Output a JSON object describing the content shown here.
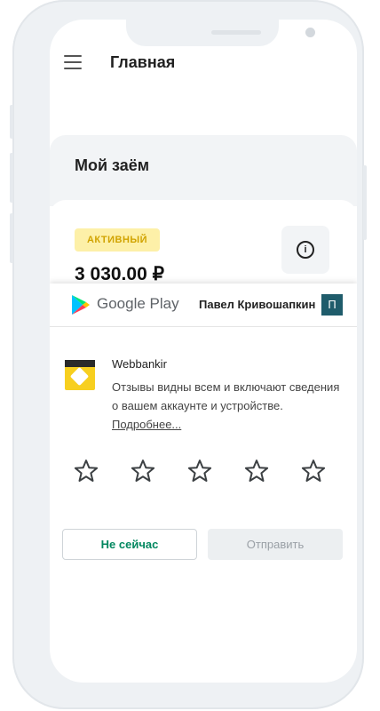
{
  "app_bar": {
    "title": "Главная",
    "menu_icon": "hamburger-menu-icon"
  },
  "loan": {
    "section_title": "Мой заём",
    "status_badge": "АКТИВНЫЙ",
    "amount": "3 030.00 ₽",
    "info_icon": "info-icon"
  },
  "review_sheet": {
    "store_name": "Google Play",
    "user_name": "Павел Кривошапкин",
    "avatar_letter": "П",
    "app_name": "Webbankir",
    "description": "Отзывы видны всем и включают сведения о вашем аккаунте и устройстве.",
    "more_link": "Подробнее...",
    "stars": [
      {
        "icon": "star-outline-icon"
      },
      {
        "icon": "star-outline-icon"
      },
      {
        "icon": "star-outline-icon"
      },
      {
        "icon": "star-outline-icon"
      },
      {
        "icon": "star-outline-icon"
      }
    ],
    "later_label": "Не сейчас",
    "send_label": "Отправить"
  },
  "colors": {
    "accent_green": "#01875f",
    "badge_bg": "#fdf0a8",
    "badge_text": "#d1a300",
    "avatar_bg": "#1f5c6b",
    "app_icon_bg": "#f7cf1f"
  }
}
